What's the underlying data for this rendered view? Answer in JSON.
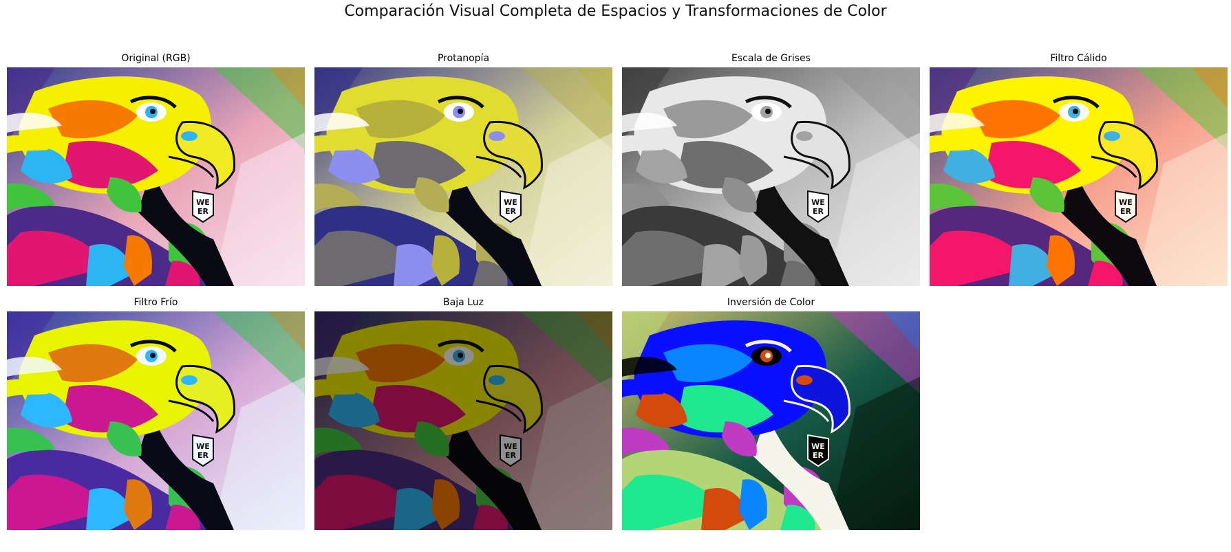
{
  "figure": {
    "title": "Comparación Visual Completa de Espacios y Transformaciones de Color"
  },
  "panels": [
    {
      "title": "Original (RGB)",
      "image": "eagle-original-rgb",
      "filter": "none",
      "palette": {
        "bg1": "#2f3f8f",
        "bg2": "#e9a6b9",
        "bg3": "#f9e4ef",
        "crest": "#f4f000",
        "orange": "#f77a00",
        "magenta": "#e11670",
        "cyan": "#2bb5f2",
        "green": "#41c43d",
        "purple": "#4c2a8a",
        "beak": "#f2ea22",
        "dark": "#0a0a14",
        "light": "#ffffff"
      }
    },
    {
      "title": "Protanopía",
      "image": "eagle-protanopia",
      "filter": "protanopia",
      "palette": {
        "bg1": "#3b3a86",
        "bg2": "#d3d197",
        "bg3": "#f2f0d8",
        "crest": "#e0dd30",
        "orange": "#b7b13c",
        "magenta": "#6d6b70",
        "cyan": "#8c8ef0",
        "green": "#b3ad55",
        "purple": "#2f2f86",
        "beak": "#e4dd3a",
        "dark": "#0a0a14",
        "light": "#ffffff"
      }
    },
    {
      "title": "Escala de Grises",
      "image": "eagle-grayscale",
      "filter": "grayscale",
      "palette": {
        "bg1": "#4a4a4a",
        "bg2": "#bdbdbd",
        "bg3": "#ebebeb",
        "crest": "#e8e8e8",
        "orange": "#9a9a9a",
        "magenta": "#6e6e6e",
        "cyan": "#a3a3a3",
        "green": "#8f8f8f",
        "purple": "#3a3a3a",
        "beak": "#e2e2e2",
        "dark": "#111111",
        "light": "#ffffff"
      }
    },
    {
      "title": "Filtro Cálido",
      "image": "eagle-warm-filter",
      "filter": "warm",
      "palette": {
        "bg1": "#3a4a86",
        "bg2": "#f7a18f",
        "bg3": "#fde4cf",
        "crest": "#fff400",
        "orange": "#ff7400",
        "magenta": "#f3166a",
        "cyan": "#3fb0e0",
        "green": "#5cc438",
        "purple": "#55287e",
        "beak": "#fbe920",
        "dark": "#0d0a0f",
        "light": "#fffaf0"
      }
    },
    {
      "title": "Filtro Frío",
      "image": "eagle-cool-filter",
      "filter": "cool",
      "palette": {
        "bg1": "#2b3f9a",
        "bg2": "#d7a9d6",
        "bg3": "#eaf0fb",
        "crest": "#e8f400",
        "orange": "#e07a10",
        "magenta": "#cc1890",
        "cyan": "#2cb8ff",
        "green": "#36c150",
        "purple": "#4a2aa0",
        "beak": "#e5ef22",
        "dark": "#080a18",
        "light": "#f2f8ff"
      }
    },
    {
      "title": "Baja Luz",
      "image": "eagle-low-light",
      "filter": "low-light",
      "palette": {
        "bg1": "#121a3a",
        "bg2": "#6e4a50",
        "bg3": "#8a7a78",
        "crest": "#8a8500",
        "orange": "#8a4400",
        "magenta": "#7d0c3e",
        "cyan": "#1a6688",
        "green": "#246f22",
        "purple": "#2a1848",
        "beak": "#8a8412",
        "dark": "#050508",
        "light": "#8e8e8e"
      }
    },
    {
      "title": "Inversión de Color",
      "image": "eagle-color-inversion",
      "filter": "invert",
      "palette": {
        "bg1": "#d0c070",
        "bg2": "#165946",
        "bg3": "#061b10",
        "crest": "#0b0fff",
        "orange": "#0885ff",
        "magenta": "#1ee98f",
        "cyan": "#d44a0d",
        "green": "#be3bc2",
        "purple": "#b3d575",
        "beak": "#0d15dd",
        "dark": "#f5f5eb",
        "light": "#000000"
      }
    }
  ]
}
